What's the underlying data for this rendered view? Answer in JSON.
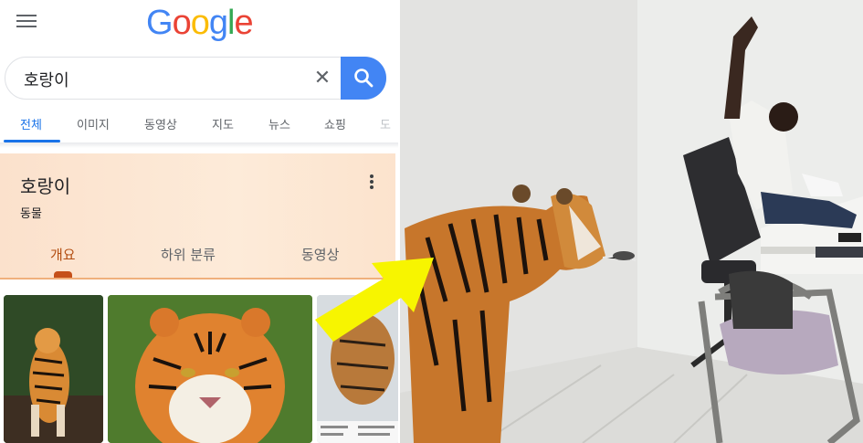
{
  "header": {
    "menu_icon": "hamburger-menu-icon",
    "logo_letters": [
      "G",
      "o",
      "o",
      "g",
      "l",
      "e"
    ]
  },
  "search": {
    "query": "호랑이",
    "clear_icon": "close-icon",
    "clear_glyph": "✕",
    "search_icon": "search-icon"
  },
  "tabs": [
    {
      "label": "전체",
      "active": true
    },
    {
      "label": "이미지",
      "active": false
    },
    {
      "label": "동영상",
      "active": false
    },
    {
      "label": "지도",
      "active": false
    },
    {
      "label": "뉴스",
      "active": false
    },
    {
      "label": "쇼핑",
      "active": false
    },
    {
      "label": "도",
      "active": false
    }
  ],
  "knowledge_panel": {
    "title": "호랑이",
    "subtitle": "동물",
    "more_icon": "more-vertical-icon",
    "tabs": [
      {
        "label": "개요",
        "active": true
      },
      {
        "label": "하위 분류",
        "active": false
      },
      {
        "label": "동영상",
        "active": false
      }
    ]
  },
  "images": [
    {
      "name": "tiger-stretching-thumbnail"
    },
    {
      "name": "tiger-face-thumbnail"
    },
    {
      "name": "tiger-info-card-thumbnail"
    }
  ],
  "photo": {
    "description_icon": "ar-tiger-photo",
    "arrow_color": "#f7f500"
  },
  "colors": {
    "accent": "#1a73e8",
    "search_button": "#4285f4",
    "panel_background": "#fde7d3",
    "panel_accent": "#c5501a"
  }
}
